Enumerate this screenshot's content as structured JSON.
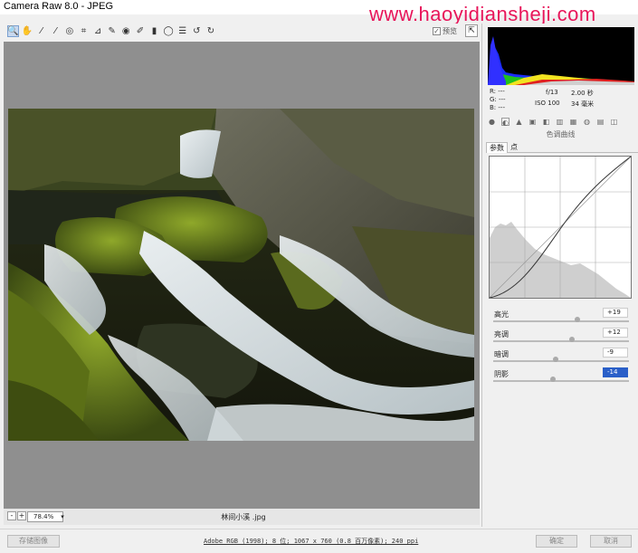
{
  "window": {
    "title": "Camera Raw 8.0 -  JPEG",
    "watermark": "www.haoyidiansheji.com"
  },
  "toolbar": {
    "tools": [
      {
        "icon": "zoom-icon",
        "glyph": "🔍",
        "active": true
      },
      {
        "icon": "hand-icon",
        "glyph": "✋"
      },
      {
        "icon": "white-balance-icon",
        "glyph": "⁄"
      },
      {
        "icon": "color-sampler-icon",
        "glyph": "⁄"
      },
      {
        "icon": "targeted-adjustment-icon",
        "glyph": "◎"
      },
      {
        "icon": "crop-icon",
        "glyph": "⌗"
      },
      {
        "icon": "straighten-icon",
        "glyph": "⊿"
      },
      {
        "icon": "spot-removal-icon",
        "glyph": "✎"
      },
      {
        "icon": "red-eye-icon",
        "glyph": "◉"
      },
      {
        "icon": "adjustment-brush-icon",
        "glyph": "✐"
      },
      {
        "icon": "graduated-filter-icon",
        "glyph": "▮"
      },
      {
        "icon": "radial-filter-icon",
        "glyph": "◯"
      },
      {
        "icon": "preferences-icon",
        "glyph": "☰"
      },
      {
        "icon": "rotate-left-icon",
        "glyph": "↺"
      },
      {
        "icon": "rotate-right-icon",
        "glyph": "↻"
      }
    ],
    "preview_label": "预览",
    "preview_checked": true,
    "fullscreen_glyph": "⇱"
  },
  "bottom": {
    "zoom_out_glyph": "-",
    "zoom_in_glyph": "+",
    "zoom_value": "78.4%",
    "zoom_drop_glyph": "▾",
    "filename": "林间小溪 .jpg"
  },
  "footer": {
    "save_label": "存储图像",
    "info": "Adobe RGB (1998); 8 位; 1067 x 760 (0.8 百万像素); 240 ppi",
    "ok_label": "确定",
    "cancel_label": "取消"
  },
  "panel": {
    "rgb": [
      "R:",
      "G:",
      "B:"
    ],
    "rgb_dashes": "---",
    "aperture": "f/13",
    "shutter": "2.00 秒",
    "iso": "ISO 100",
    "focal": "34 毫米",
    "tab_icons": [
      "basic-icon",
      "tone-curve-icon",
      "detail-icon",
      "hsl-icon",
      "split-toning-icon",
      "lens-icon",
      "effects-icon",
      "camera-calibration-icon",
      "presets-icon",
      "snapshots-icon"
    ],
    "section_title": "色调曲线",
    "subtabs": [
      "参数",
      "点"
    ],
    "sliders": [
      {
        "label": "高光",
        "value": "+19",
        "pos": 0.62
      },
      {
        "label": "亮调",
        "value": "+12",
        "pos": 0.58
      },
      {
        "label": "暗调",
        "value": "-9",
        "pos": 0.46
      },
      {
        "label": "阴影",
        "value": "-14",
        "pos": 0.44,
        "focused": true
      }
    ]
  },
  "colors": {
    "watermark": "#e8155a",
    "canvas_bg": "#8f8f8f",
    "focus_blue": "#2a5fc8"
  }
}
